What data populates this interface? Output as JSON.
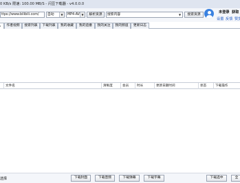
{
  "window": {
    "title": "0 KB/s 限速: 100.00 MB/S - 闪豆下载器 - v4.0.0.0"
  },
  "toolbar": {
    "url_value": "ttps://www.bilibili.com/",
    "mode_value": "自动",
    "format_value": "MP4-AVC",
    "parse_button": "解析资源",
    "search_value": "搜索内容",
    "search_button": "搜索资源"
  },
  "user": {
    "name": "未登录",
    "extra": "获取",
    "settings": "设置",
    "feedback": "反馈",
    "donate": "赞赏"
  },
  "tabs": [
    {
      "label": "作者视频"
    },
    {
      "label": "搜索列表"
    },
    {
      "label": "下载列表"
    },
    {
      "label": "我的收藏"
    },
    {
      "label": "我的追番"
    },
    {
      "label": "我的关注"
    },
    {
      "label": "我的频道"
    },
    {
      "label": "更新日志"
    }
  ],
  "table": {
    "columns": [
      "文件名",
      "清晰度",
      "会员",
      "时长",
      "更新日期时间",
      "状态",
      "下载操作"
    ]
  },
  "bottom": {
    "select_all_label": "选择",
    "buttons": [
      "下载封面",
      "下载音频",
      "下载弹幕",
      "下载字幕",
      "下载选中",
      "全"
    ]
  },
  "colors": {
    "accent": "#3b82e0",
    "link": "#1a56c4",
    "titlebar": "#dfe5f0"
  }
}
